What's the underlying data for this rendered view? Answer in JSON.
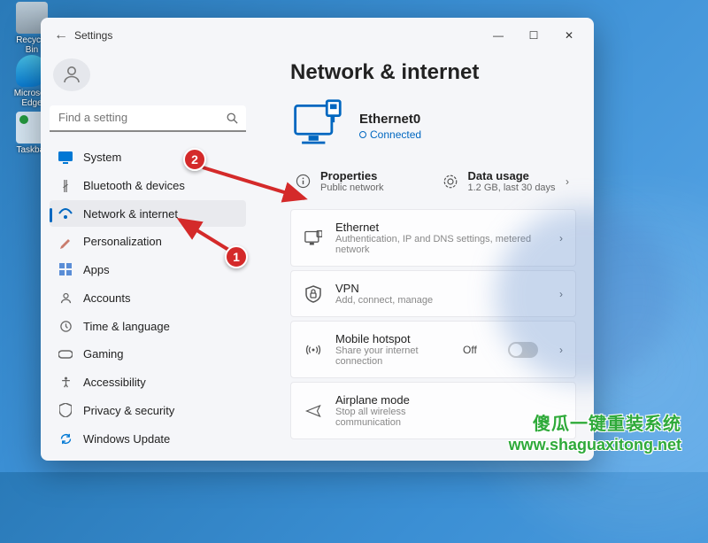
{
  "desktop": {
    "icons": [
      "Recycle Bin",
      "Microsoft Edge",
      "Taskbar"
    ]
  },
  "window": {
    "title": "Settings",
    "search_placeholder": "Find a setting"
  },
  "sidebar": {
    "items": [
      {
        "label": "System",
        "icon_color": "#0078d4"
      },
      {
        "label": "Bluetooth & devices",
        "icon_color": "#555"
      },
      {
        "label": "Network & internet",
        "icon_color": "#0067c0"
      },
      {
        "label": "Personalization",
        "icon_color": "#d06050"
      },
      {
        "label": "Apps",
        "icon_color": "#555"
      },
      {
        "label": "Accounts",
        "icon_color": "#555"
      },
      {
        "label": "Time & language",
        "icon_color": "#555"
      },
      {
        "label": "Gaming",
        "icon_color": "#555"
      },
      {
        "label": "Accessibility",
        "icon_color": "#555"
      },
      {
        "label": "Privacy & security",
        "icon_color": "#555"
      },
      {
        "label": "Windows Update",
        "icon_color": "#0078d4"
      }
    ],
    "selected_index": 2
  },
  "main": {
    "page_title": "Network & internet",
    "connection": {
      "name": "Ethernet0",
      "status": "Connected"
    },
    "quick": {
      "properties": {
        "title": "Properties",
        "sub": "Public network"
      },
      "usage": {
        "title": "Data usage",
        "sub": "1.2 GB, last 30 days"
      }
    },
    "cards": [
      {
        "title": "Ethernet",
        "sub": "Authentication, IP and DNS settings, metered network"
      },
      {
        "title": "VPN",
        "sub": "Add, connect, manage"
      },
      {
        "title": "Mobile hotspot",
        "sub": "Share your internet connection",
        "toggle": "Off"
      },
      {
        "title": "Airplane mode",
        "sub": "Stop all wireless communication"
      }
    ]
  },
  "annotations": {
    "badge1": "1",
    "badge2": "2"
  },
  "watermark": {
    "line1": "傻瓜一键重装系统",
    "line2": "www.shaguaxitong.net"
  }
}
